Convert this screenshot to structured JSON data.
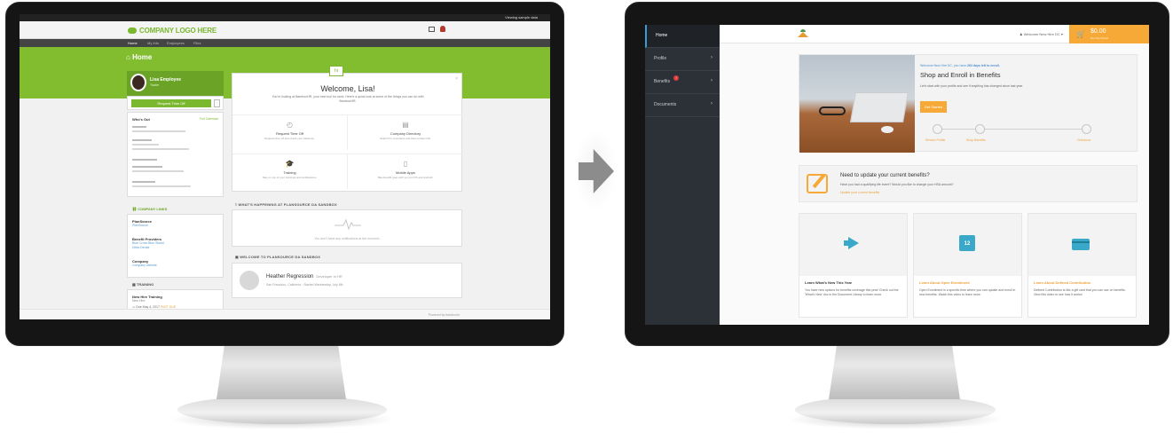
{
  "left_app": {
    "topbar": {
      "viewing_label": "Viewing sample data"
    },
    "logo_text": "COMPANY LOGO HERE",
    "nav": [
      "Home",
      "My Info",
      "Employees",
      "Files"
    ],
    "page_title": "Home",
    "profile": {
      "name": "Lisa Employee",
      "role": "Trader"
    },
    "time_off_button": "Request Time Off",
    "whos_out": {
      "title": "Who's Out",
      "full_calendar": "Full Calendar"
    },
    "company_links": {
      "title": "COMPANY LINKS",
      "items": [
        {
          "title": "PlanSource",
          "sub": "PlanSource"
        },
        {
          "title": "Benefit Providers",
          "sub": "Blue Cross Blue Shield",
          "sub2": "Delta Dental"
        },
        {
          "title": "Company",
          "sub": "Company website"
        }
      ]
    },
    "training": {
      "title": "TRAINING",
      "course": "New Hire Training",
      "sub": "New Hire",
      "due": "Due May 4, 2017",
      "due_status": "PAST DUE"
    },
    "welcome": {
      "badge": "hi",
      "title": "Welcome, Lisa!",
      "subtitle": "You're looking at BambooHR, your new tool for work. Here's a quick look at some of the things you can do with BambooHR.",
      "tiles": [
        {
          "icon": "time-off-icon",
          "glyph": "◴",
          "title": "Request Time Off",
          "sub": "Request time off and check your balances."
        },
        {
          "icon": "directory-icon",
          "glyph": "▤",
          "title": "Company Directory",
          "sub": "Search for coworkers and their contact info."
        },
        {
          "icon": "training-icon",
          "glyph": "🎓",
          "title": "Training",
          "sub": "Stay on top of your trainings and certifications."
        },
        {
          "icon": "mobile-icon",
          "glyph": "▯",
          "title": "Mobile Apps",
          "sub": "BambooHR goes with you on iOS and Android."
        }
      ]
    },
    "happening": {
      "label": "WHAT'S HAPPENING AT PLANSOURCE DA SANDBOX",
      "empty": "You don't have any notifications at the moment..."
    },
    "welcome_to": {
      "label": "WELCOME TO PLANSOURCE DA SANDBOX",
      "person": "Heather Regression",
      "role": "Developer in HR",
      "location": "San Francisco, California · Started Wednesday, July 8th"
    },
    "footer": {
      "powered": "Powered by bamboohr"
    }
  },
  "right_app": {
    "sidebar": [
      {
        "label": "Home",
        "active": true,
        "chevron": false,
        "badge": ""
      },
      {
        "label": "Profile",
        "active": false,
        "chevron": true,
        "badge": ""
      },
      {
        "label": "Benefits",
        "active": false,
        "chevron": true,
        "badge": "!"
      },
      {
        "label": "Documents",
        "active": false,
        "chevron": true,
        "badge": ""
      }
    ],
    "header": {
      "welcome_user": "Welcome New Hire DC ▾",
      "cart_amount": "$0.00",
      "cart_sub": "Per Pay Period"
    },
    "hero": {
      "alert_prefix": "Welcome New Hire DC, you have ",
      "alert_days": "263 days left to enroll.",
      "title": "Shop and Enroll in Benefits",
      "subtitle": "Let's start with your profile and see if anything has changed since last year.",
      "button": "Get Started",
      "steps": [
        "Review Profile",
        "Shop Benefits",
        "Checkout"
      ]
    },
    "update": {
      "title": "Need to update your current benefits?",
      "question": "Have you had a qualifying life event? Would you like to change your HSA amount?",
      "link": "Update your current benefits"
    },
    "cards": [
      {
        "icon": "megaphone-icon",
        "title": "Learn What's New This Year",
        "title_color": "#333333",
        "desc": "You have new options for benefits coverage this year! Check out the 'What's New' doc in the Document Library to learn more."
      },
      {
        "icon": "calendar-icon",
        "calendar_day": "12",
        "title": "Learn About Open Enrollment",
        "title_color": "#f0a03a",
        "desc": "Open Enrollment is a specific time where you can update and enroll in new benefits. Watch this video to learn more."
      },
      {
        "icon": "credit-card-icon",
        "title": "Learn About Defined Contribution",
        "title_color": "#f0a03a",
        "desc": "Defined Contribution is like a gift card that you can use on benefits. View this video to see how it works!"
      }
    ],
    "colors": {
      "accent": "#f6a936",
      "sidebar": "#2c3037",
      "icon": "#3aa9c9"
    }
  },
  "apple_glyph": ""
}
